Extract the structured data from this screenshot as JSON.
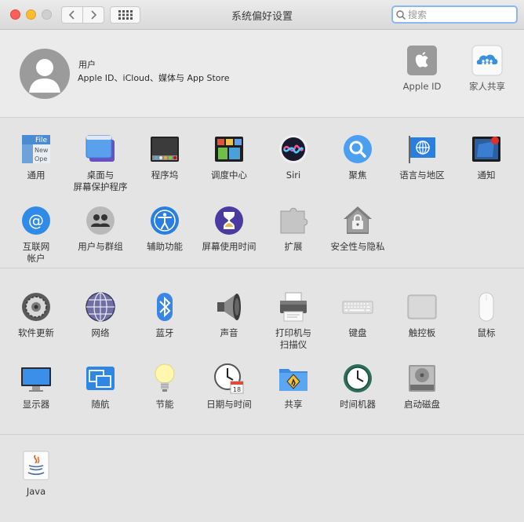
{
  "window": {
    "title": "系统偏好设置",
    "search_placeholder": "搜索"
  },
  "account": {
    "name": "用户",
    "subtitle": "Apple ID、iCloud、媒体与 App Store",
    "apple_id_label": "Apple ID",
    "family_label": "家人共享"
  },
  "section1": [
    {
      "label": "通用",
      "icon": "general-icon"
    },
    {
      "label": "桌面与\n屏幕保护程序",
      "icon": "desktop-icon"
    },
    {
      "label": "程序坞",
      "icon": "dock-icon"
    },
    {
      "label": "调度中心",
      "icon": "mission-control-icon"
    },
    {
      "label": "Siri",
      "icon": "siri-icon"
    },
    {
      "label": "聚焦",
      "icon": "spotlight-icon"
    },
    {
      "label": "语言与地区",
      "icon": "language-icon"
    },
    {
      "label": "通知",
      "icon": "notifications-icon"
    },
    {
      "label": "互联网\n帐户",
      "icon": "internet-accounts-icon"
    },
    {
      "label": "用户与群组",
      "icon": "users-groups-icon"
    },
    {
      "label": "辅助功能",
      "icon": "accessibility-icon"
    },
    {
      "label": "屏幕使用时间",
      "icon": "screen-time-icon"
    },
    {
      "label": "扩展",
      "icon": "extensions-icon"
    },
    {
      "label": "安全性与隐私",
      "icon": "security-icon"
    }
  ],
  "section2": [
    {
      "label": "软件更新",
      "icon": "software-update-icon"
    },
    {
      "label": "网络",
      "icon": "network-icon"
    },
    {
      "label": "蓝牙",
      "icon": "bluetooth-icon"
    },
    {
      "label": "声音",
      "icon": "sound-icon"
    },
    {
      "label": "打印机与\n扫描仪",
      "icon": "printer-icon"
    },
    {
      "label": "键盘",
      "icon": "keyboard-icon"
    },
    {
      "label": "触控板",
      "icon": "trackpad-icon"
    },
    {
      "label": "鼠标",
      "icon": "mouse-icon"
    },
    {
      "label": "显示器",
      "icon": "displays-icon"
    },
    {
      "label": "随航",
      "icon": "sidecar-icon"
    },
    {
      "label": "节能",
      "icon": "energy-saver-icon"
    },
    {
      "label": "日期与时间",
      "icon": "date-time-icon"
    },
    {
      "label": "共享",
      "icon": "sharing-icon"
    },
    {
      "label": "时间机器",
      "icon": "time-machine-icon"
    },
    {
      "label": "启动磁盘",
      "icon": "startup-disk-icon"
    }
  ],
  "section3": [
    {
      "label": "Java",
      "icon": "java-icon"
    }
  ],
  "calendar_day": "18",
  "general_icon_text": [
    "File",
    "New",
    "Ope"
  ]
}
